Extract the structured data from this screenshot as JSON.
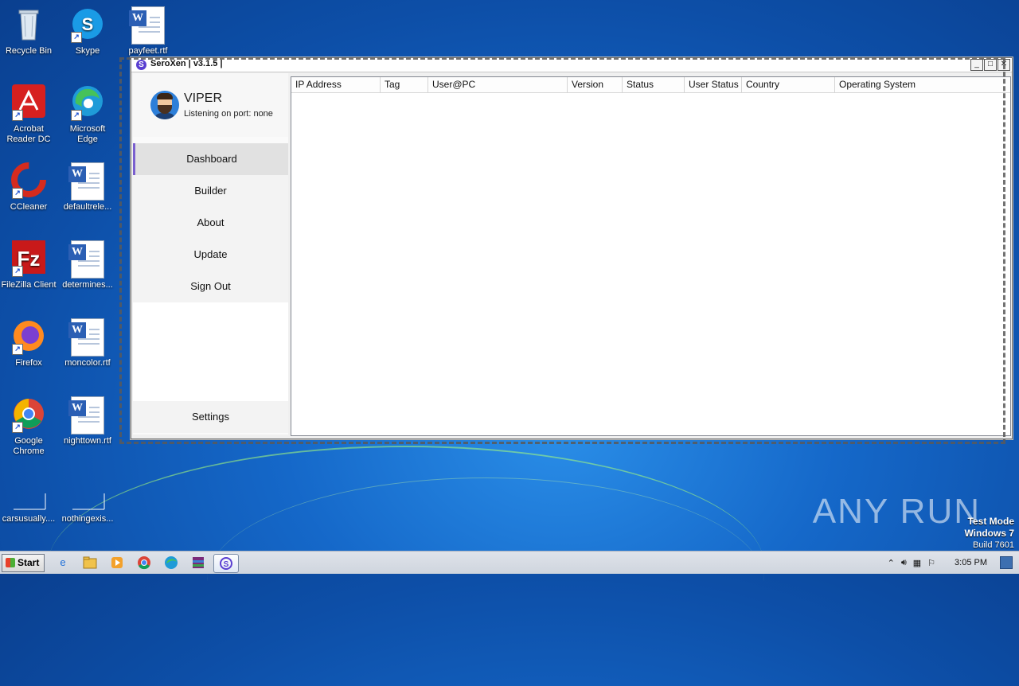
{
  "desktop": {
    "icons": [
      {
        "label": "Recycle Bin",
        "icon": "recycle-bin-icon"
      },
      {
        "label": "Skype",
        "icon": "skype-icon"
      },
      {
        "label": "payfeet.rtf",
        "icon": "word-document-icon"
      },
      {
        "label": "Acrobat Reader DC",
        "icon": "acrobat-icon"
      },
      {
        "label": "Microsoft Edge",
        "icon": "edge-icon"
      },
      {
        "label": "CCleaner",
        "icon": "ccleaner-icon"
      },
      {
        "label": "defaultrele...",
        "icon": "word-document-icon"
      },
      {
        "label": "FileZilla Client",
        "icon": "filezilla-icon"
      },
      {
        "label": "determines...",
        "icon": "word-document-icon"
      },
      {
        "label": "Firefox",
        "icon": "firefox-icon"
      },
      {
        "label": "moncolor.rtf",
        "icon": "word-document-icon"
      },
      {
        "label": "Google Chrome",
        "icon": "chrome-icon"
      },
      {
        "label": "nighttown.rtf",
        "icon": "word-document-icon"
      },
      {
        "label": "carsusually....",
        "icon": "blank-file-icon"
      },
      {
        "label": "nothingexis...",
        "icon": "blank-file-icon"
      }
    ],
    "watermark": "ANY RUN",
    "test_mode": {
      "line1": "Test Mode",
      "line2": "Windows 7",
      "line3": "Build 7601"
    }
  },
  "window": {
    "title": "SeroXen | v3.1.5 |",
    "profile": {
      "name": "VIPER",
      "status": "Listening on port: none"
    },
    "nav": [
      {
        "label": "Dashboard",
        "active": true
      },
      {
        "label": "Builder"
      },
      {
        "label": "About"
      },
      {
        "label": "Update"
      },
      {
        "label": "Sign Out"
      }
    ],
    "settings_label": "Settings",
    "table": {
      "columns": [
        "IP Address",
        "Tag",
        "User@PC",
        "Version",
        "Status",
        "User Status",
        "Country",
        "Operating System"
      ],
      "rows": []
    },
    "accent_color": "#7a5fcf"
  },
  "taskbar": {
    "start_label": "Start",
    "clock": "3:05 PM",
    "apps": [
      "ie-icon",
      "explorer-icon",
      "media-player-icon",
      "chrome-icon",
      "edge-icon",
      "winrar-icon",
      "seroxen-icon"
    ]
  }
}
